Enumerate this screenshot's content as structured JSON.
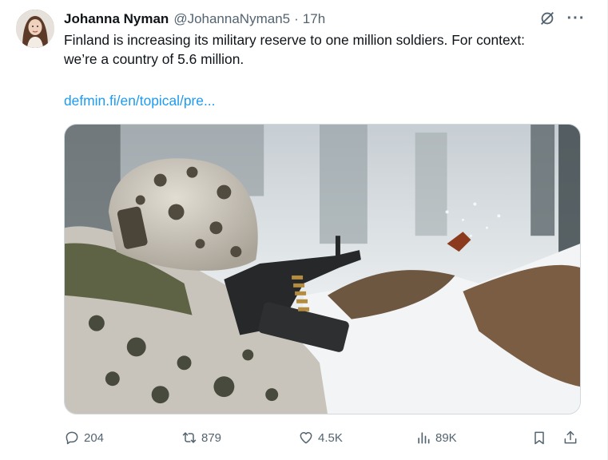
{
  "tweet": {
    "author": {
      "display_name": "Johanna Nyman",
      "handle": "@JohannaNyman5",
      "separator": "·",
      "time": "17h"
    },
    "text_line_1": "Finland is increasing its military reserve to one million soldiers. For context:",
    "text_line_2": "we’re a country of 5.6 million.",
    "link": "defmin.fi/en/topical/pre...",
    "icons": {
      "grok": "grok-icon",
      "more": "more-icon",
      "more_glyph": "···"
    },
    "actions": {
      "replies": "204",
      "reposts": "879",
      "likes": "4.5K",
      "views": "89K"
    }
  },
  "colors": {
    "text": "#0f1419",
    "secondary": "#536471",
    "link": "#1d9bf0",
    "border": "#cfd9de"
  }
}
